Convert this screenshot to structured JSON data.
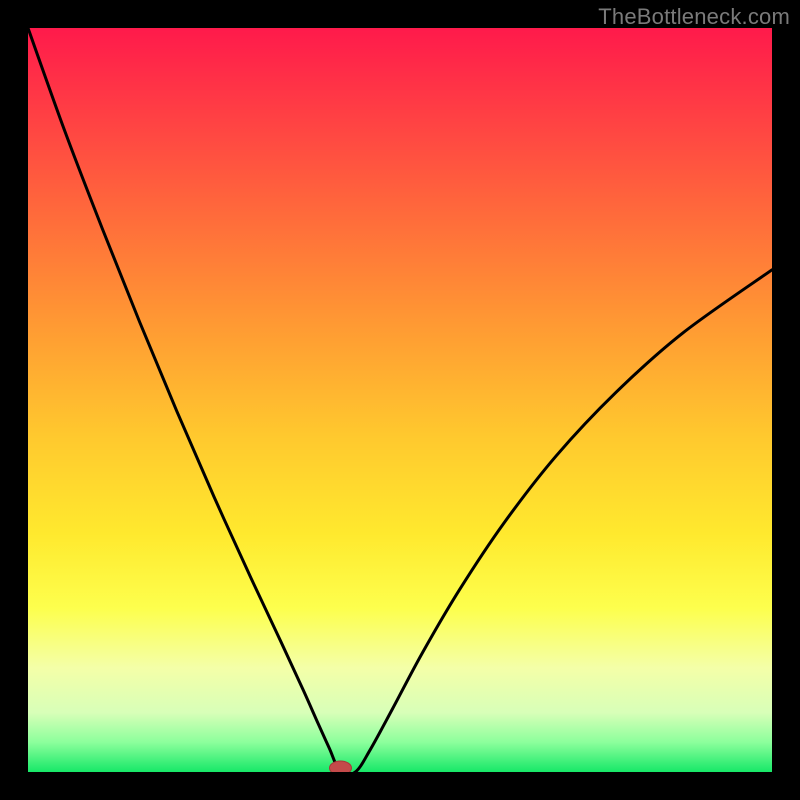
{
  "watermark": "TheBottleneck.com",
  "chart_data": {
    "type": "line",
    "title": "",
    "xlabel": "",
    "ylabel": "",
    "xlim": [
      0,
      100
    ],
    "ylim": [
      0,
      100
    ],
    "min_point": {
      "x": 42,
      "y": 0
    },
    "marker": {
      "x": 42,
      "y": 0,
      "color": "#c44a4a"
    },
    "series": [
      {
        "name": "curve",
        "x": [
          0,
          5,
          10,
          15,
          20,
          25,
          30,
          34,
          37,
          39,
          40.5,
          42,
          44,
          46,
          49,
          53,
          58,
          64,
          71,
          79,
          88,
          100
        ],
        "y": [
          100,
          86,
          73,
          60.5,
          48.5,
          37,
          26,
          17.5,
          11,
          6.5,
          3.2,
          0,
          0,
          3,
          8.5,
          16,
          24.5,
          33.5,
          42.5,
          51,
          59,
          67.5
        ]
      }
    ]
  },
  "colors": {
    "curve_stroke": "#000000",
    "marker_fill": "#c44a4a",
    "marker_stroke": "#a63838",
    "background_black": "#000000"
  }
}
